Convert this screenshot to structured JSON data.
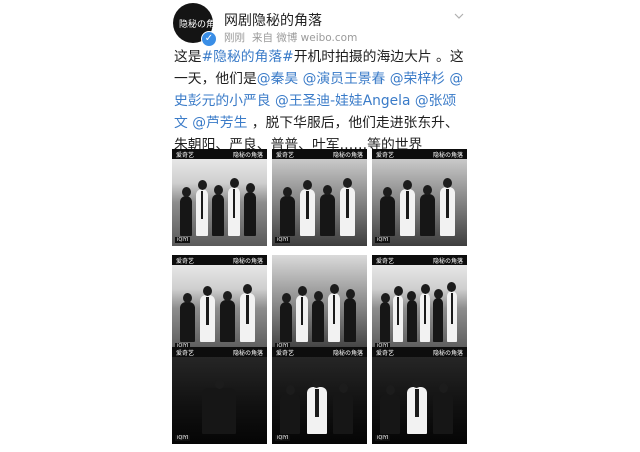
{
  "author": {
    "name": "网剧隐秘的角落",
    "avatar_text": "隐秘の角落",
    "verified": true
  },
  "meta": {
    "time": "刚刚",
    "source": "来自 微博 weibo.com"
  },
  "post": {
    "segments": [
      {
        "text": "这是",
        "link": false
      },
      {
        "text": "#隐秘的角落#",
        "link": true
      },
      {
        "text": "开机时拍摄的海边大片 。这一天，他们是",
        "link": false
      },
      {
        "text": "@秦昊",
        "link": true
      },
      {
        "text": " ",
        "link": false
      },
      {
        "text": "@演员王景春",
        "link": true
      },
      {
        "text": " ",
        "link": false
      },
      {
        "text": "@荣梓杉",
        "link": true
      },
      {
        "text": " ",
        "link": false
      },
      {
        "text": "@史彭元的小严良",
        "link": true
      },
      {
        "text": " ",
        "link": false
      },
      {
        "text": "@王圣迪-娃娃Angela",
        "link": true
      },
      {
        "text": " ",
        "link": false
      },
      {
        "text": "@张颂文",
        "link": true
      },
      {
        "text": " ",
        "link": false
      },
      {
        "text": "@芦芳生",
        "link": true
      },
      {
        "text": " ，脱下华服后，他们走进张东升、朱朝阳、严良、普普、叶军……等的世界",
        "link": false
      }
    ]
  },
  "photos": {
    "banner_left": "爱奇艺",
    "banner_right": "隐秘の角落",
    "footer": "iQIYI",
    "items": [
      {
        "tone": "sea",
        "figures": 5,
        "banner": true
      },
      {
        "tone": "mid",
        "figures": 4,
        "banner": true
      },
      {
        "tone": "mid",
        "figures": 4,
        "banner": true
      },
      {
        "tone": "sea",
        "figures": 4,
        "banner": true
      },
      {
        "tone": "mid",
        "figures": 5,
        "banner": false
      },
      {
        "tone": "sea",
        "figures": 6,
        "banner": true
      },
      {
        "tone": "dark",
        "figures": 1,
        "banner": true
      },
      {
        "tone": "dark",
        "figures": 3,
        "banner": true
      },
      {
        "tone": "dark",
        "figures": 3,
        "banner": true
      }
    ]
  },
  "colors": {
    "link": "#3a7bc8",
    "text": "#1f1f1f",
    "meta": "#9a9a9a",
    "verified": "#3a8ee6"
  },
  "icons": {
    "menu": "chevron-down-icon",
    "verified": "verified-badge-icon"
  }
}
